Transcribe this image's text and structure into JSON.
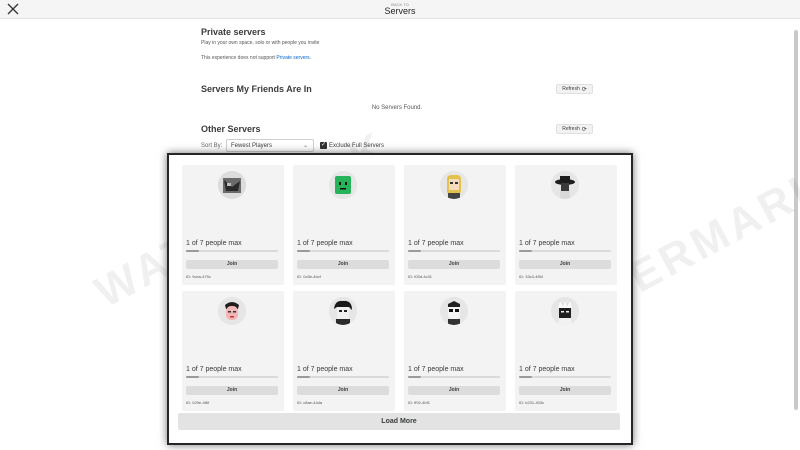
{
  "header": {
    "supertitle": "BACK TO",
    "title": "Servers"
  },
  "private": {
    "title": "Private servers",
    "subtitle": "Play in your own space, solo or with people you invite",
    "notice": "This experience does not support",
    "notice_link": "Private servers."
  },
  "friends": {
    "title": "Servers My Friends Are In",
    "refresh_label": "Refresh",
    "empty": "No Servers Found."
  },
  "other": {
    "title": "Other Servers",
    "refresh_label": "Refresh",
    "sort_label": "Sort By:",
    "sort_value": "Fewest Players",
    "exclude_label": "Exclude Full Servers",
    "exclude_checked": true
  },
  "watermark": "WATERMARK",
  "servers": [
    {
      "count": "1 of 7 people max",
      "fill": 0.14,
      "join": "Join",
      "id": "ID: 9cea-479c",
      "avatar": "grey-camo"
    },
    {
      "count": "1 of 7 people max",
      "fill": 0.14,
      "join": "Join",
      "id": "ID: 0c5b-4bcf",
      "avatar": "green-block"
    },
    {
      "count": "1 of 7 people max",
      "fill": 0.14,
      "join": "Join",
      "id": "ID: f03d-4c31",
      "avatar": "blonde"
    },
    {
      "count": "1 of 7 people max",
      "fill": 0.14,
      "join": "Join",
      "id": "ID: 33c3-4f54",
      "avatar": "black-hat"
    },
    {
      "count": "1 of 7 people max",
      "fill": 0.14,
      "join": "Join",
      "id": "ID: 029e-4f6f",
      "avatar": "pink-face"
    },
    {
      "count": "1 of 7 people max",
      "fill": 0.14,
      "join": "Join",
      "id": "ID: c8ae-44da",
      "avatar": "dark-hair"
    },
    {
      "count": "1 of 7 people max",
      "fill": 0.14,
      "join": "Join",
      "id": "ID: ff92-4bf1",
      "avatar": "masked"
    },
    {
      "count": "1 of 7 people max",
      "fill": 0.14,
      "join": "Join",
      "id": "ID: b231-403c",
      "avatar": "white-hair"
    }
  ],
  "load_more": "Load More",
  "colors": {
    "page_bg": "#ffffff",
    "card_bg": "#f3f3f3",
    "button_bg": "#dcdcdc",
    "link": "#0066cc",
    "popup_border": "#262626"
  }
}
